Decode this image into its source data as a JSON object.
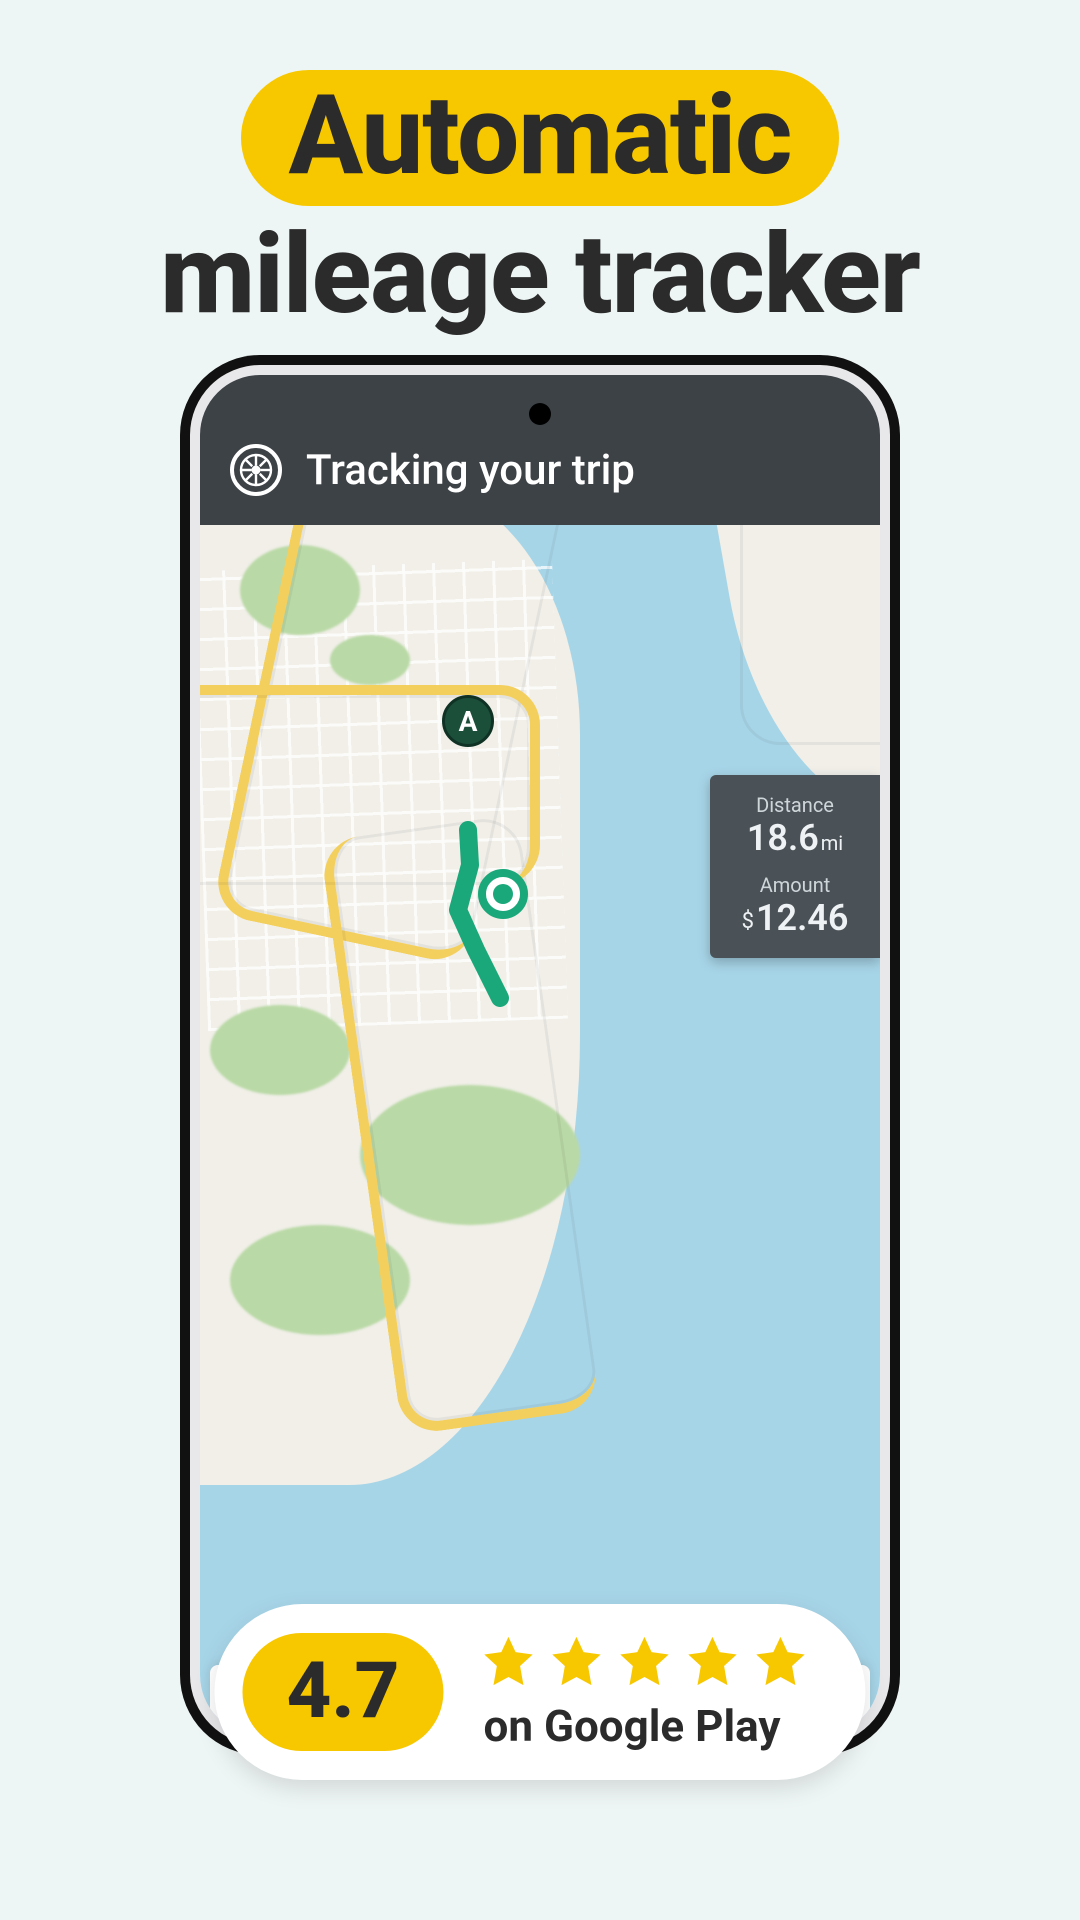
{
  "headline": {
    "highlight": "Automatic",
    "sub": "mileage tracker"
  },
  "app": {
    "header_title": "Tracking your trip",
    "route_start_label": "A",
    "trip": {
      "distance_label": "Distance",
      "distance_value": "18.6",
      "distance_unit": "mi",
      "amount_label": "Amount",
      "amount_symbol": "$",
      "amount_value": "12.46"
    }
  },
  "rating": {
    "score": "4.7",
    "star_count": 5,
    "source": "on Google Play"
  }
}
